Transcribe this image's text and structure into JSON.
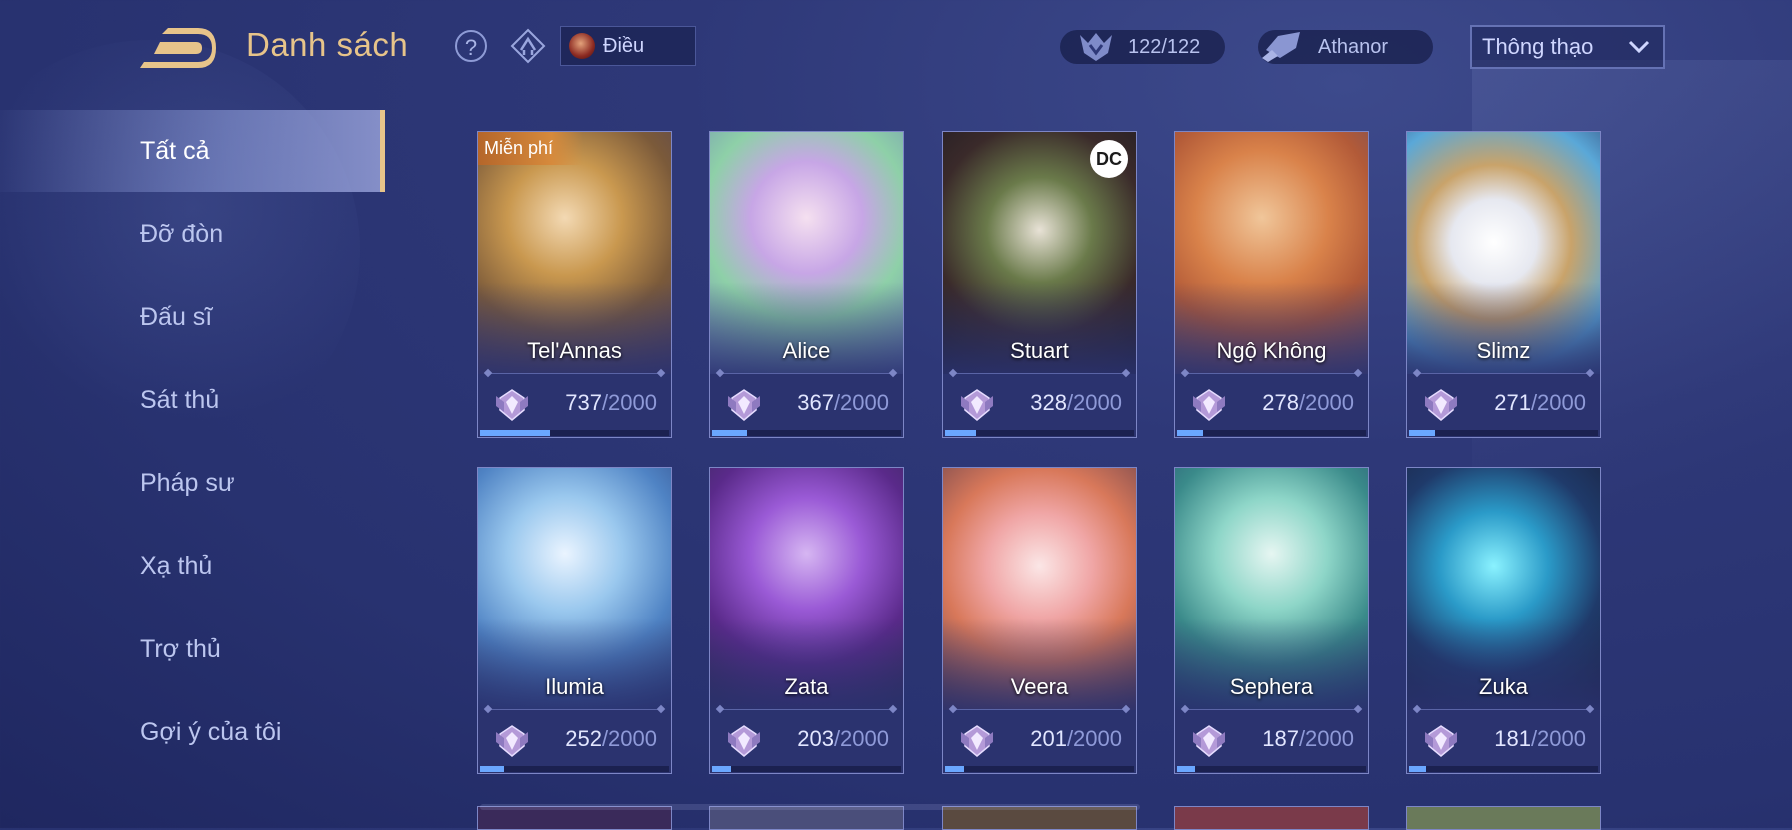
{
  "header": {
    "title": "Danh sách",
    "help_label": "?",
    "hero_chip_label": "Điều",
    "heroes_owned": "122/122",
    "player_name": "Athanor",
    "sort_value": "Thông thạo"
  },
  "sidebar": {
    "items": [
      {
        "label": "Tất cả",
        "active": true
      },
      {
        "label": "Đỡ đòn"
      },
      {
        "label": "Đấu sĩ"
      },
      {
        "label": "Sát thủ"
      },
      {
        "label": "Pháp sư"
      },
      {
        "label": "Xạ thủ"
      },
      {
        "label": "Trợ thủ"
      },
      {
        "label": "Gợi ý của tôi"
      }
    ]
  },
  "colors": {
    "title": "#e7c48a",
    "accent_bar": "#6aa7ff",
    "active_border": "#e7c48a"
  },
  "heroes": [
    {
      "name": "Tel'Annas",
      "points": "737",
      "max": "/2000",
      "progress": 0.3685,
      "badge": "Miễn phí",
      "art": "blonde"
    },
    {
      "name": "Alice",
      "points": "367",
      "max": "/2000",
      "progress": 0.1835,
      "art": "pastel"
    },
    {
      "name": "Stuart",
      "points": "328",
      "max": "/2000",
      "progress": 0.164,
      "logo": "DC",
      "art": "joker"
    },
    {
      "name": "Ngộ Không",
      "points": "278",
      "max": "/2000",
      "progress": 0.139,
      "art": "monkey"
    },
    {
      "name": "Slimz",
      "points": "271",
      "max": "/2000",
      "progress": 0.1355,
      "art": "slimz"
    },
    {
      "name": "Ilumia",
      "points": "252",
      "max": "/2000",
      "progress": 0.126,
      "art": "ice"
    },
    {
      "name": "Zata",
      "points": "203",
      "max": "/2000",
      "progress": 0.1015,
      "art": "purple"
    },
    {
      "name": "Veera",
      "points": "201",
      "max": "/2000",
      "progress": 0.1005,
      "art": "rose"
    },
    {
      "name": "Sephera",
      "points": "187",
      "max": "/2000",
      "progress": 0.0935,
      "art": "teal"
    },
    {
      "name": "Zuka",
      "points": "181",
      "max": "/2000",
      "progress": 0.0905,
      "art": "neon"
    }
  ]
}
